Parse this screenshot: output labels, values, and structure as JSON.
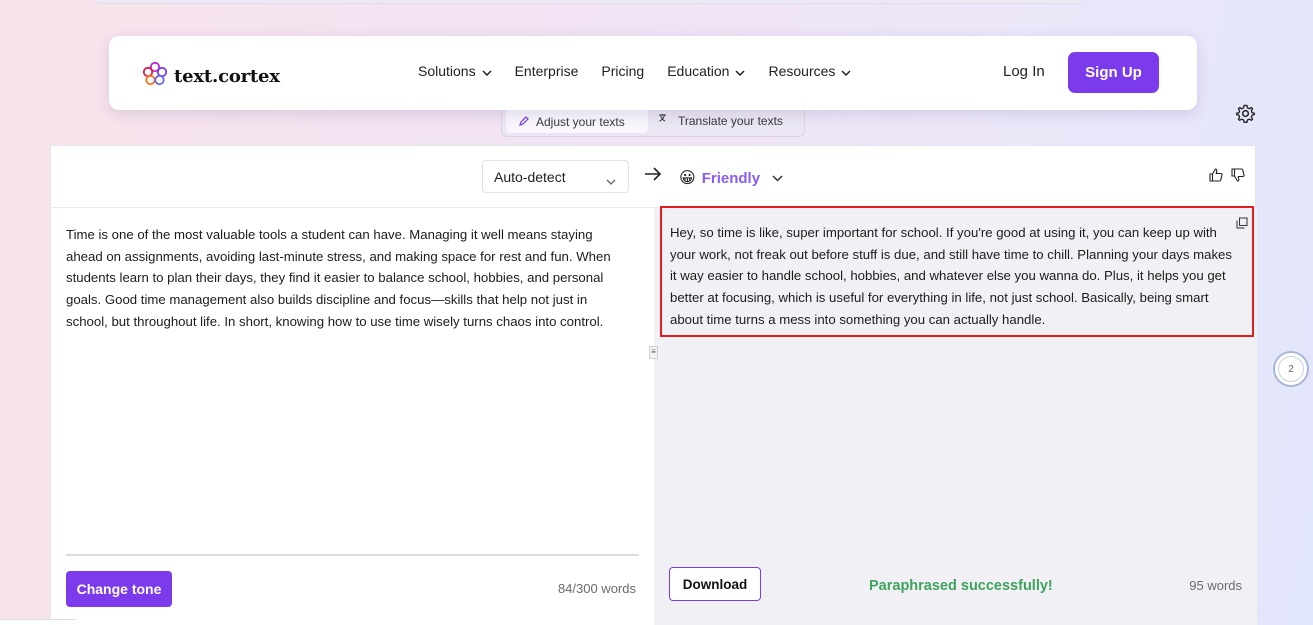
{
  "brand": {
    "name": "text.cortex",
    "logo_icon": "flower-logo-icon",
    "accent_color": "#7c3aed"
  },
  "nav": {
    "items": [
      {
        "label": "Solutions",
        "has_dropdown": true
      },
      {
        "label": "Enterprise",
        "has_dropdown": false
      },
      {
        "label": "Pricing",
        "has_dropdown": false
      },
      {
        "label": "Education",
        "has_dropdown": true
      },
      {
        "label": "Resources",
        "has_dropdown": true
      }
    ],
    "login_label": "Log In",
    "signup_label": "Sign Up"
  },
  "mode_tabs": {
    "adjust_label": "Adjust your texts",
    "translate_label": "Translate your texts"
  },
  "toolbar": {
    "source_language": "Auto-detect",
    "tone": "Friendly",
    "tone_emoji": "😀"
  },
  "input": {
    "text": "Time is one of the most valuable tools a student can have. Managing it well means staying ahead on assignments, avoiding last-minute stress, and making space for rest and fun. When students learn to plan their days, they find it easier to balance school, hobbies, and personal goals. Good time management also builds discipline and focus—skills that help not just in school, but throughout life. In short, knowing how to use time wisely turns chaos into control.",
    "word_count": "84/300 words",
    "change_tone_label": "Change tone"
  },
  "output": {
    "text": "Hey, so time is like, super important for school. If you're good at using it, you can keep up with your work, not freak out before stuff is due, and still have time to chill. Planning your days makes it way easier to handle school, hobbies, and whatever else you wanna do. Plus, it helps you get better at focusing, which is useful for everything in life, not just school. Basically, being smart about time turns a mess into something you can actually handle.",
    "word_count": "95 words",
    "download_label": "Download",
    "status": "Paraphrased successfully!",
    "status_color": "#3da35d"
  },
  "floating_badge": {
    "count": "2"
  }
}
